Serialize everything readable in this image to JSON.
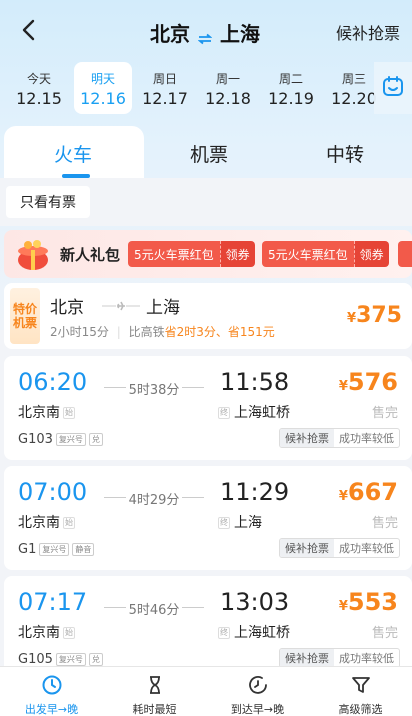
{
  "header": {
    "from": "北京",
    "to": "上海",
    "waitlist_label": "候补抢票"
  },
  "dates": [
    {
      "weekday": "今天",
      "date": "12.15"
    },
    {
      "weekday": "明天",
      "date": "12.16",
      "active": true
    },
    {
      "weekday": "周日",
      "date": "12.17"
    },
    {
      "weekday": "周一",
      "date": "12.18"
    },
    {
      "weekday": "周二",
      "date": "12.19"
    },
    {
      "weekday": "周三",
      "date": "12.20"
    }
  ],
  "tabs": [
    "火车",
    "机票",
    "中转"
  ],
  "filter": {
    "only_available": "只看有票"
  },
  "promo": {
    "title": "新人礼包",
    "coupons": [
      {
        "text": "5元火车票红包",
        "action": "领券"
      },
      {
        "text": "5元火车票红包",
        "action": "领券"
      }
    ]
  },
  "flight": {
    "badge_line1": "特价",
    "badge_line2": "机票",
    "from": "北京",
    "to": "上海",
    "duration": "2小时15分",
    "compare_prefix": "比高铁",
    "compare_highlight": "省2时3分、省151元",
    "currency": "¥",
    "price": "375"
  },
  "trains": [
    {
      "dep_time": "06:20",
      "duration": "5时38分",
      "arr_time": "11:58",
      "dep_station": "北京南",
      "dep_tag": "始",
      "arr_station": "上海虹桥",
      "arr_tag": "终",
      "currency": "¥",
      "price": "576",
      "status": "售完",
      "train_no": "G103",
      "tags": [
        "复兴号",
        "兑"
      ],
      "waitlist": "候补抢票",
      "success_rate": "成功率较低"
    },
    {
      "dep_time": "07:00",
      "duration": "4时29分",
      "arr_time": "11:29",
      "dep_station": "北京南",
      "dep_tag": "始",
      "arr_station": "上海",
      "arr_tag": "终",
      "currency": "¥",
      "price": "667",
      "status": "售完",
      "train_no": "G1",
      "tags": [
        "复兴号",
        "静音"
      ],
      "waitlist": "候补抢票",
      "success_rate": "成功率较低"
    },
    {
      "dep_time": "07:17",
      "duration": "5时46分",
      "arr_time": "13:03",
      "dep_station": "北京南",
      "dep_tag": "始",
      "arr_station": "上海虹桥",
      "arr_tag": "终",
      "currency": "¥",
      "price": "553",
      "status": "售完",
      "train_no": "G105",
      "tags": [
        "复兴号",
        "兑"
      ],
      "waitlist": "候补抢票",
      "success_rate": "成功率较低"
    }
  ],
  "bottom_bar": [
    {
      "label": "出发早→晚",
      "icon": "clock-icon",
      "active": true
    },
    {
      "label": "耗时最短",
      "icon": "hourglass-icon"
    },
    {
      "label": "到达早→晚",
      "icon": "clock-arrival-icon"
    },
    {
      "label": "高级筛选",
      "icon": "filter-icon"
    }
  ],
  "colors": {
    "accent": "#1a95ee",
    "price": "#f7851d",
    "promo_red": "#f25a4a"
  }
}
